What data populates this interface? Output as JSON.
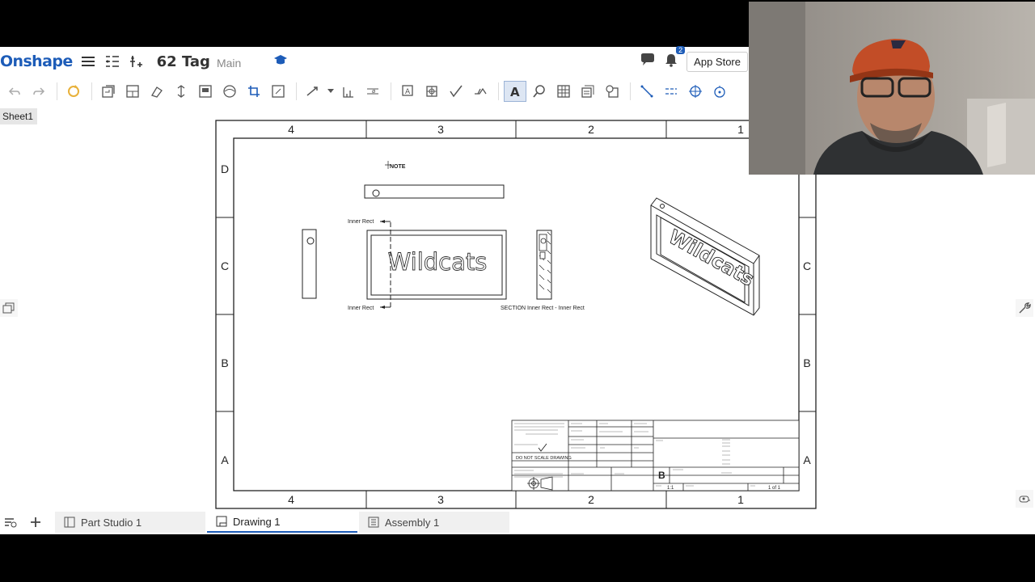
{
  "header": {
    "logo": "Onshape",
    "document_title": "62 Tag",
    "branch": "Main",
    "notification_count": "2",
    "app_store_label": "App Store"
  },
  "sheet_tab": "Sheet1",
  "drawing": {
    "zone_columns": [
      "4",
      "3",
      "2",
      "1"
    ],
    "zone_rows": [
      "D",
      "C",
      "B",
      "A"
    ],
    "note_text": "NOTE",
    "part_text": "Wildcats",
    "section_label_top": "Inner Rect",
    "section_label_bottom": "Inner Rect",
    "section_caption": "SECTION Inner Rect - Inner Rect",
    "title_block": {
      "do_not_scale": "DO NOT SCALE DRAWING",
      "size": "B",
      "scale": "1:1",
      "sheet": "1 of 1"
    }
  },
  "bottom_tabs": [
    {
      "label": "Part Studio 1",
      "icon": "part-studio-icon"
    },
    {
      "label": "Drawing 1",
      "icon": "drawing-icon"
    },
    {
      "label": "Assembly 1",
      "icon": "assembly-icon"
    }
  ],
  "colors": {
    "brand": "#1d5cb8",
    "active_tab_underline": "#1d5cb8"
  }
}
